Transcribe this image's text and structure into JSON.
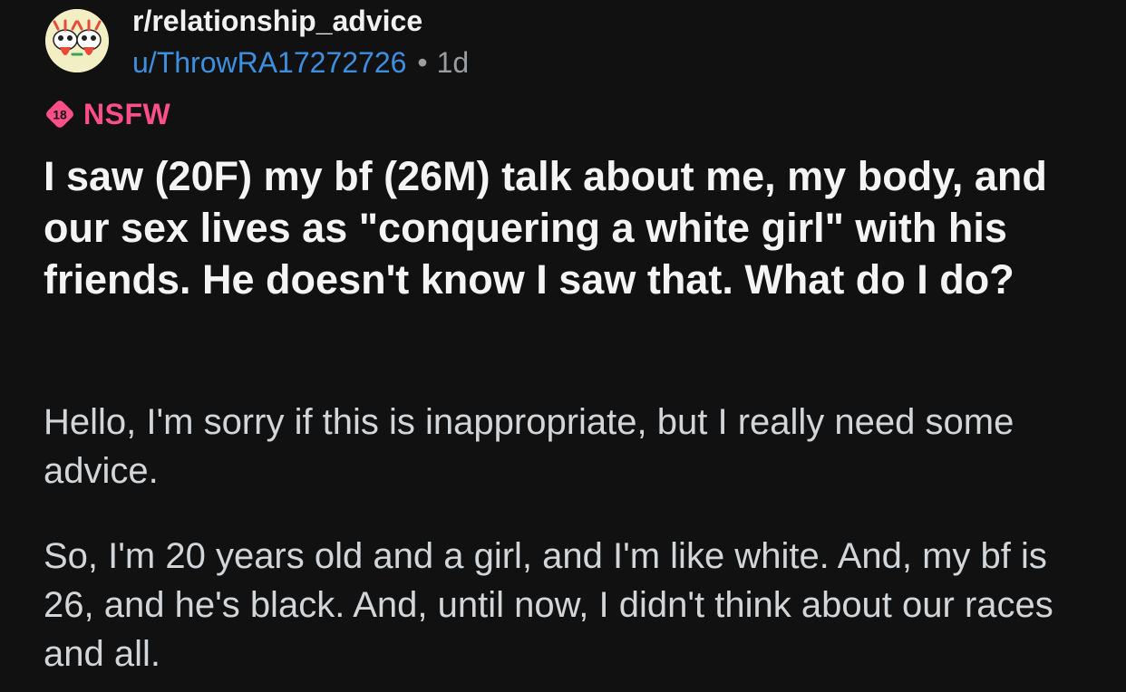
{
  "post": {
    "subreddit": "r/relationship_advice",
    "author": "u/ThrowRA17272726",
    "separator": "•",
    "age": "1d",
    "nsfw": {
      "icon_text": "18",
      "label": "NSFW",
      "color": "#ff4f8b"
    },
    "title": "I saw (20F) my bf (26M) talk about me, my body, and our sex lives as \"conquering a white girl\" with his friends. He doesn't know I saw that. What do I do?",
    "body": [
      "Hello, I'm sorry if this is inappropriate, but I really need some advice.",
      "So, I'm 20 years old and a girl, and I'm like white. And, my bf is 26, and he's black. And, until now, I didn't think about our races and all."
    ]
  },
  "icons": {
    "avatar": "subreddit-avatar-icon",
    "nsfw": "nsfw-18-icon"
  },
  "colors": {
    "background": "#111111",
    "author_link": "#3d8fe0",
    "nsfw_accent": "#ff4f8b",
    "title_text": "#f4f4f4",
    "body_text": "#d3d6d9",
    "muted_text": "#9a9da0"
  }
}
